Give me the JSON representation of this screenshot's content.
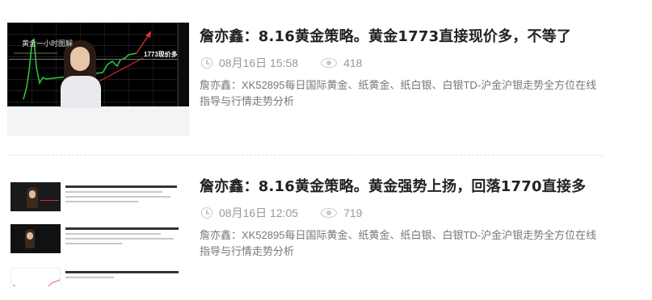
{
  "articles": [
    {
      "title": "詹亦鑫：8.16黄金策略。黄金1773直接现价多，不等了",
      "date": "08月16日 15:58",
      "views": "418",
      "summary": "詹亦鑫：XK52895每日国际黄金、纸黄金、纸白银、白银TD-沪金沪银走势全方位在线指导与行情走势分析",
      "thumb_caption": "黄金一小时图解",
      "thumb_label": "1773现价多"
    },
    {
      "title": "詹亦鑫：8.16黄金策略。黄金强势上扬，回落1770直接多",
      "date": "08月16日 12:05",
      "views": "719",
      "summary": "詹亦鑫：XK52895每日国际黄金、纸黄金、纸白银、白银TD-沪金沪银走势全方位在线指导与行情走势分析"
    }
  ],
  "icons": {
    "time": "clock-icon",
    "views": "eye-icon"
  },
  "colors": {
    "title": "#222222",
    "meta": "#999999",
    "summary": "#777777",
    "chart_line": "#2ecc40",
    "arrow": "#e0302a"
  }
}
